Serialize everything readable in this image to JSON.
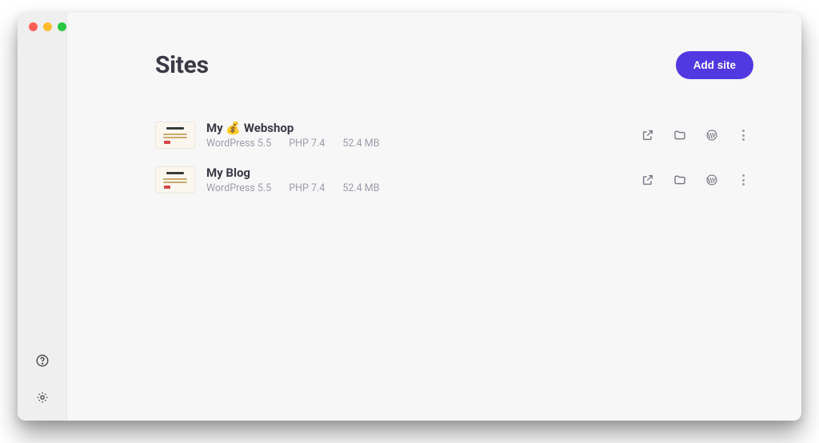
{
  "header": {
    "title": "Sites",
    "add_label": "Add site"
  },
  "sites": [
    {
      "name": "My 💰 Webshop",
      "wp": "WordPress 5.5",
      "php": "PHP 7.4",
      "size": "52.4 MB"
    },
    {
      "name": "My Blog",
      "wp": "WordPress 5.5",
      "php": "PHP 7.4",
      "size": "52.4 MB"
    }
  ]
}
